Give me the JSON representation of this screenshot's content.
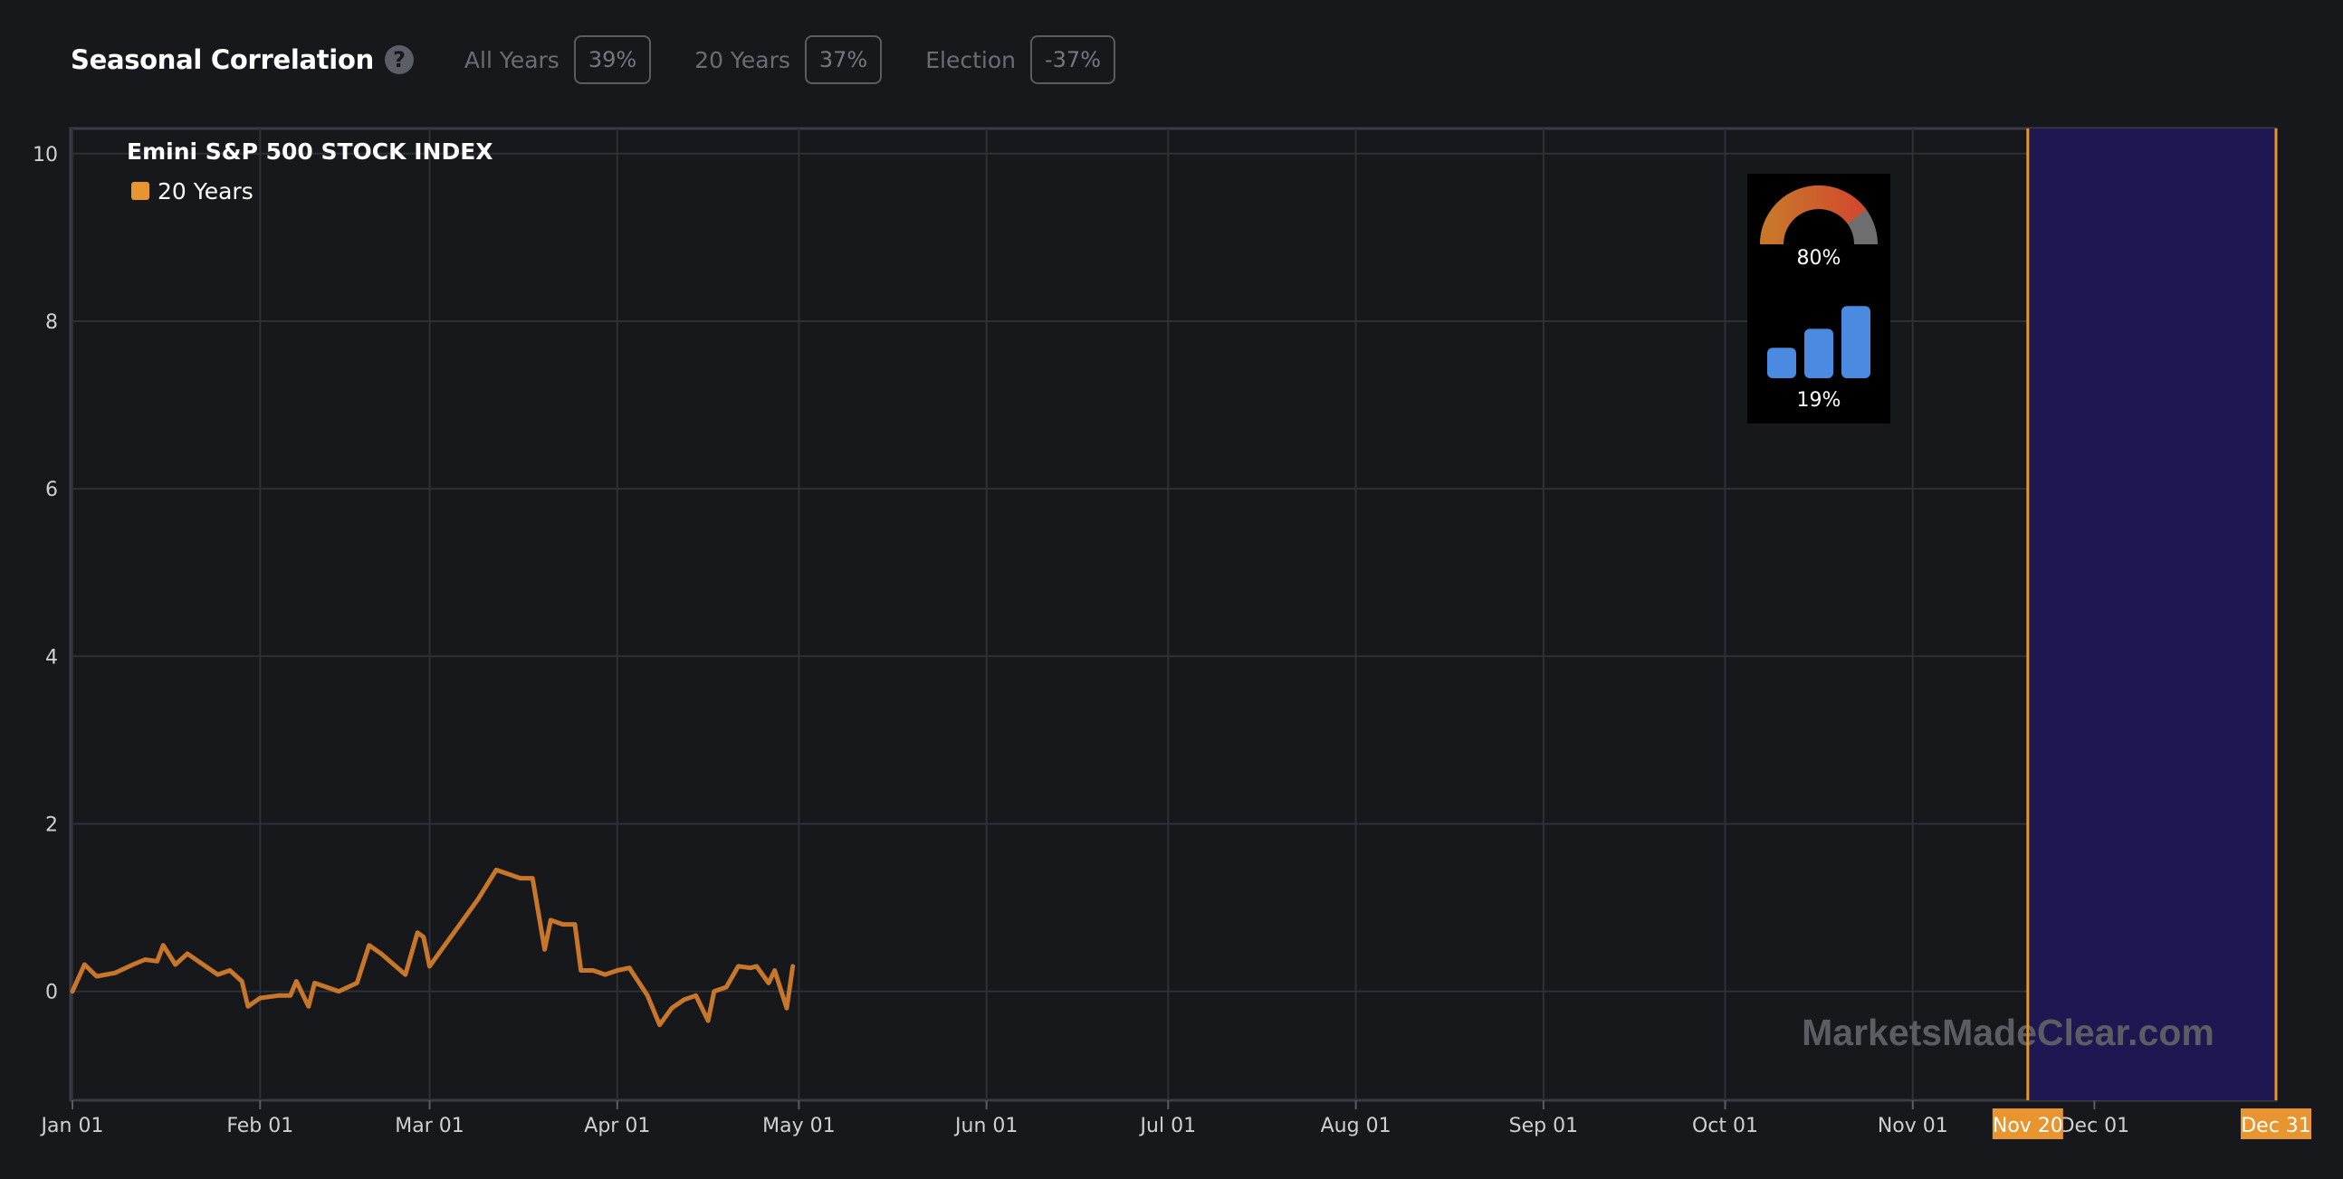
{
  "header": {
    "title": "Seasonal Correlation",
    "help_icon": "question-icon",
    "stats": [
      {
        "label": "All Years",
        "value": "39%"
      },
      {
        "label": "20 Years",
        "value": "37%"
      },
      {
        "label": "Election",
        "value": "-37%"
      }
    ]
  },
  "watermark": "MarketsMadeClear.com",
  "overlay": {
    "gauge_value": "80%",
    "bars_value": "19%",
    "gauge_fraction": 0.8,
    "bar_levels": [
      0.4,
      0.65,
      0.95
    ]
  },
  "colors": {
    "line": "#c8762a",
    "highlight": "#1f1752",
    "accent": "#e8952f",
    "gauge_gray": "#6e6e6e",
    "gauge_red": "#d24a2e",
    "bar_blue": "#4a8ae0"
  },
  "chart_data": {
    "type": "line",
    "title": "Emini S&P 500 STOCK INDEX",
    "legend": {
      "position": "top-left",
      "entries": [
        "20 Years"
      ]
    },
    "grid": true,
    "xlim": [
      "Jan 01",
      "Dec 31"
    ],
    "ylim": [
      -1.3,
      10.3
    ],
    "y_ticks": [
      "0",
      "2",
      "4",
      "6",
      "8",
      "10"
    ],
    "x_ticks": [
      "Jan 01",
      "Feb 01",
      "Mar 01",
      "Apr 01",
      "May 01",
      "Jun 01",
      "Jul 01",
      "Aug 01",
      "Sep 01",
      "Oct 01",
      "Nov 01",
      "Dec 01"
    ],
    "highlight_range": {
      "start": "Nov 20",
      "end": "Dec 31"
    },
    "series": [
      {
        "name": "20 Years",
        "points": [
          [
            "Jan 01",
            0.0
          ],
          [
            "Jan 03",
            0.32
          ],
          [
            "Jan 05",
            0.18
          ],
          [
            "Jan 08",
            0.22
          ],
          [
            "Jan 11",
            0.32
          ],
          [
            "Jan 13",
            0.38
          ],
          [
            "Jan 15",
            0.36
          ],
          [
            "Jan 16",
            0.55
          ],
          [
            "Jan 18",
            0.32
          ],
          [
            "Jan 20",
            0.45
          ],
          [
            "Jan 23",
            0.3
          ],
          [
            "Jan 25",
            0.2
          ],
          [
            "Jan 27",
            0.25
          ],
          [
            "Jan 29",
            0.12
          ],
          [
            "Jan 30",
            -0.18
          ],
          [
            "Feb 01",
            -0.08
          ],
          [
            "Feb 04",
            -0.05
          ],
          [
            "Feb 06",
            -0.05
          ],
          [
            "Feb 07",
            0.12
          ],
          [
            "Feb 09",
            -0.18
          ],
          [
            "Feb 10",
            0.1
          ],
          [
            "Feb 12",
            0.05
          ],
          [
            "Feb 14",
            0.0
          ],
          [
            "Feb 17",
            0.1
          ],
          [
            "Feb 19",
            0.55
          ],
          [
            "Feb 21",
            0.45
          ],
          [
            "Feb 25",
            0.2
          ],
          [
            "Feb 27",
            0.7
          ],
          [
            "Feb 28",
            0.65
          ],
          [
            "Mar 01",
            0.3
          ],
          [
            "Mar 03",
            0.5
          ],
          [
            "Mar 06",
            0.8
          ],
          [
            "Mar 09",
            1.1
          ],
          [
            "Mar 12",
            1.45
          ],
          [
            "Mar 14",
            1.4
          ],
          [
            "Mar 16",
            1.35
          ],
          [
            "Mar 18",
            1.35
          ],
          [
            "Mar 20",
            0.5
          ],
          [
            "Mar 21",
            0.85
          ],
          [
            "Mar 23",
            0.8
          ],
          [
            "Mar 25",
            0.8
          ],
          [
            "Mar 26",
            0.25
          ],
          [
            "Mar 28",
            0.25
          ],
          [
            "Mar 30",
            0.2
          ],
          [
            "Apr 01",
            0.25
          ],
          [
            "Apr 03",
            0.28
          ],
          [
            "Apr 06",
            -0.05
          ],
          [
            "Apr 08",
            -0.4
          ],
          [
            "Apr 10",
            -0.2
          ],
          [
            "Apr 12",
            -0.1
          ],
          [
            "Apr 14",
            -0.05
          ],
          [
            "Apr 16",
            -0.35
          ],
          [
            "Apr 17",
            0.0
          ],
          [
            "Apr 19",
            0.05
          ],
          [
            "Apr 21",
            0.3
          ],
          [
            "Apr 23",
            0.28
          ],
          [
            "Apr 24",
            0.3
          ],
          [
            "Apr 26",
            0.1
          ],
          [
            "Apr 27",
            0.25
          ],
          [
            "Apr 29",
            -0.2
          ],
          [
            "Apr 30",
            0.3
          ]
        ]
      }
    ]
  }
}
